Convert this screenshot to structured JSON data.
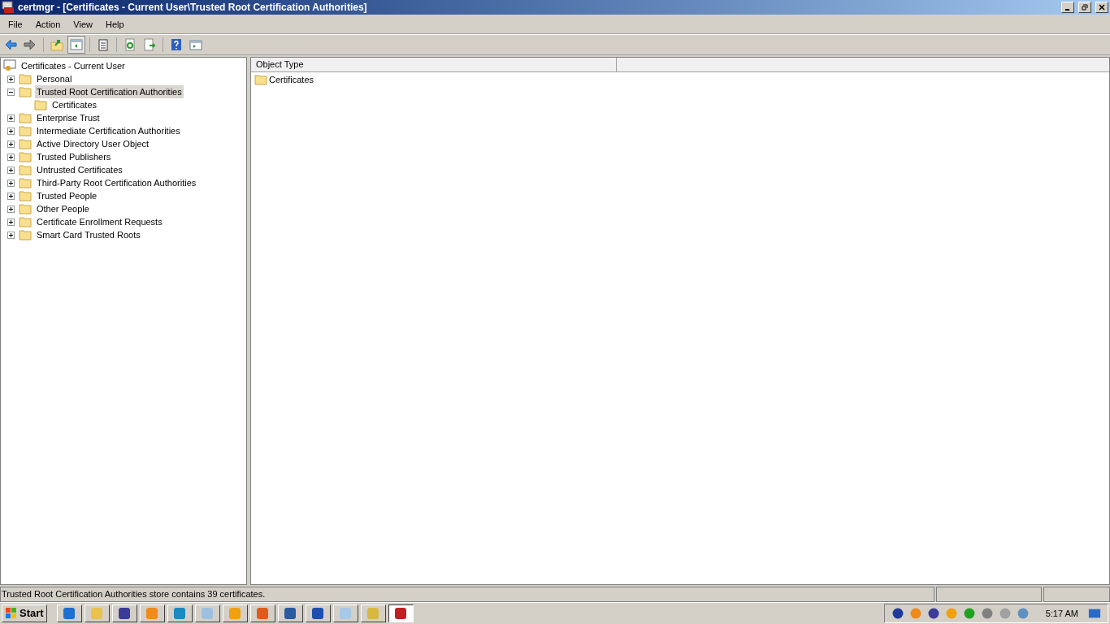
{
  "window": {
    "title": "certmgr - [Certificates - Current User\\Trusted Root Certification Authorities]"
  },
  "menu": [
    "File",
    "Action",
    "View",
    "Help"
  ],
  "toolbar": [
    {
      "pressed": false
    },
    {
      "pressed": false
    },
    {
      "pressed": false
    },
    {
      "pressed": true
    },
    {
      "pressed": false
    },
    {
      "pressed": false
    },
    {
      "pressed": false
    },
    {
      "pressed": false
    },
    {
      "pressed": false
    }
  ],
  "tree": {
    "label": "Certificates - Current User",
    "children": [
      {
        "label": "Personal",
        "expanded": false,
        "selected": false
      },
      {
        "label": "Trusted Root Certification Authorities",
        "expanded": true,
        "selected": true,
        "children": [
          {
            "label": "Certificates",
            "selected": false
          }
        ]
      },
      {
        "label": "Enterprise Trust",
        "expanded": false,
        "selected": false
      },
      {
        "label": "Intermediate Certification Authorities",
        "expanded": false,
        "selected": false
      },
      {
        "label": "Active Directory User Object",
        "expanded": false,
        "selected": false
      },
      {
        "label": "Trusted Publishers",
        "expanded": false,
        "selected": false
      },
      {
        "label": "Untrusted Certificates",
        "expanded": false,
        "selected": false
      },
      {
        "label": "Third-Party Root Certification Authorities",
        "expanded": false,
        "selected": false
      },
      {
        "label": "Trusted People",
        "expanded": false,
        "selected": false
      },
      {
        "label": "Other People",
        "expanded": false,
        "selected": false
      },
      {
        "label": "Certificate Enrollment Requests",
        "expanded": false,
        "selected": false
      },
      {
        "label": "Smart Card Trusted Roots",
        "expanded": false,
        "selected": false
      }
    ]
  },
  "list": {
    "columns": [
      "Object Type"
    ],
    "rows": [
      {
        "name": "Certificates"
      }
    ]
  },
  "status_bar": {
    "text": "Trusted Root Certification Authorities store contains 39 certificates."
  },
  "taskbar": {
    "start": "Start",
    "apps": [
      {
        "selected": false
      },
      {
        "selected": false
      },
      {
        "selected": false
      },
      {
        "selected": false
      },
      {
        "selected": false
      },
      {
        "selected": false
      },
      {
        "selected": false
      },
      {
        "selected": false
      },
      {
        "selected": false
      },
      {
        "selected": false
      },
      {
        "selected": false
      },
      {
        "selected": false
      },
      {
        "selected": true
      }
    ],
    "clock": "5:17 AM"
  }
}
